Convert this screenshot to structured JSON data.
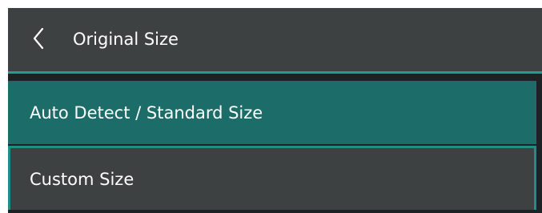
{
  "header": {
    "back_icon": "chevron-left-icon",
    "title": "Original Size"
  },
  "options": [
    {
      "label": "Auto Detect / Standard Size",
      "selected": true
    },
    {
      "label": "Custom Size",
      "selected": false
    }
  ],
  "colors": {
    "header_bg": "#3e4142",
    "accent": "#2a9a8d",
    "selected_bg": "#1c6d69",
    "item_bg": "#3e4142",
    "focus_border": "#1f8e89",
    "text": "#ffffff"
  }
}
